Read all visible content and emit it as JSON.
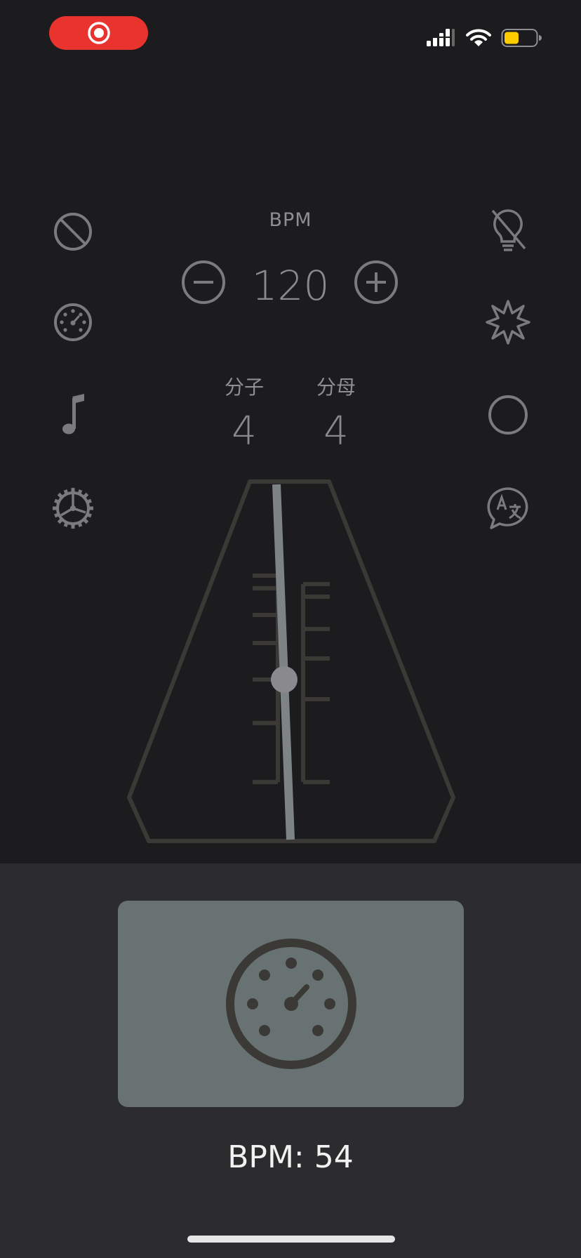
{
  "status_bar": {
    "recording_color": "#e8332f",
    "battery_color": "#ffcc00"
  },
  "left_icons": [
    "block-icon",
    "speedometer-icon",
    "music-note-icon",
    "settings-gear-icon"
  ],
  "right_icons": [
    "light-off-icon",
    "burst-icon",
    "circle-icon",
    "translate-icon"
  ],
  "bpm": {
    "label": "BPM",
    "value": "120"
  },
  "time_signature": {
    "numerator_label": "分子",
    "numerator_value": "4",
    "denominator_label": "分母",
    "denominator_value": "4"
  },
  "bottom": {
    "card_icon": "tempo-dial-icon",
    "readout": "BPM: 54"
  }
}
